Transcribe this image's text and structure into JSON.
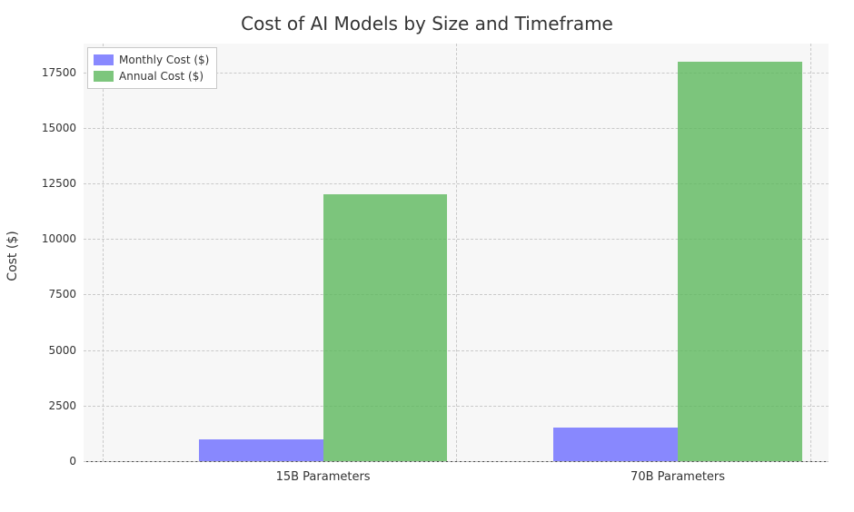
{
  "chart_data": {
    "type": "bar",
    "title": "Cost of AI Models by Size and Timeframe",
    "xlabel": "",
    "ylabel": "Cost ($)",
    "categories": [
      "15B Parameters",
      "70B Parameters"
    ],
    "series": [
      {
        "name": "Monthly Cost ($)",
        "values": [
          1000,
          1500
        ],
        "color": "#6b6bff"
      },
      {
        "name": "Annual Cost ($)",
        "values": [
          12000,
          18000
        ],
        "color": "#5cb85c"
      }
    ],
    "ylim": [
      0,
      18800
    ],
    "yticks": [
      0,
      2500,
      5000,
      7500,
      10000,
      12500,
      15000,
      17500
    ],
    "grid": true,
    "legend_position": "upper left",
    "bar_width": 0.35,
    "bar_alpha": 0.8
  }
}
